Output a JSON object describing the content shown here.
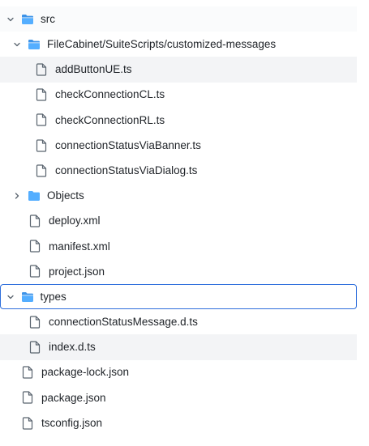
{
  "colors": {
    "folder": "#54aeff",
    "folder_open_tab": "#3d93e8",
    "file_stroke": "#59636e",
    "chevron": "#59636e",
    "focus_border": "#2f6fdc",
    "hover_bg": "#f3f4f6"
  },
  "tree": [
    {
      "type": "folder",
      "label": "src",
      "state": "expanded",
      "icon": "folder-open-icon",
      "chevron": "chevron-down-icon"
    },
    {
      "type": "folder",
      "label": "FileCabinet/SuiteScripts/customized-messages",
      "state": "expanded",
      "icon": "folder-open-icon",
      "chevron": "chevron-down-icon"
    },
    {
      "type": "file",
      "label": "addButtonUE.ts",
      "icon": "file-icon",
      "highlighted": true
    },
    {
      "type": "file",
      "label": "checkConnectionCL.ts",
      "icon": "file-icon"
    },
    {
      "type": "file",
      "label": "checkConnectionRL.ts",
      "icon": "file-icon"
    },
    {
      "type": "file",
      "label": "connectionStatusViaBanner.ts",
      "icon": "file-icon"
    },
    {
      "type": "file",
      "label": "connectionStatusViaDialog.ts",
      "icon": "file-icon"
    },
    {
      "type": "folder",
      "label": "Objects",
      "state": "collapsed",
      "icon": "folder-icon",
      "chevron": "chevron-right-icon"
    },
    {
      "type": "file",
      "label": "deploy.xml",
      "icon": "file-icon"
    },
    {
      "type": "file",
      "label": "manifest.xml",
      "icon": "file-icon"
    },
    {
      "type": "file",
      "label": "project.json",
      "icon": "file-icon"
    },
    {
      "type": "folder",
      "label": "types",
      "state": "expanded",
      "icon": "folder-open-icon",
      "chevron": "chevron-down-icon",
      "focused": true
    },
    {
      "type": "file",
      "label": "connectionStatusMessage.d.ts",
      "icon": "file-icon"
    },
    {
      "type": "file",
      "label": "index.d.ts",
      "icon": "file-icon",
      "highlighted": true
    },
    {
      "type": "file",
      "label": "package-lock.json",
      "icon": "file-icon"
    },
    {
      "type": "file",
      "label": "package.json",
      "icon": "file-icon"
    },
    {
      "type": "file",
      "label": "tsconfig.json",
      "icon": "file-icon"
    }
  ]
}
